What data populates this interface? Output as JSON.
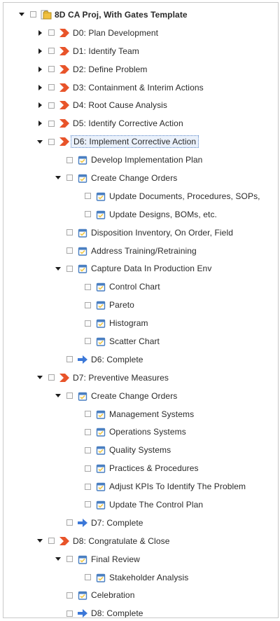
{
  "tree": {
    "rows": [
      {
        "label": "8D CA Proj, With Gates Template",
        "indent": 1,
        "toggle": "down",
        "icon": "project-folder-icon",
        "bold": true
      },
      {
        "label": "D0: Plan Development",
        "indent": 2,
        "toggle": "right",
        "icon": "phase-gate-icon"
      },
      {
        "label": "D1: Identify Team",
        "indent": 2,
        "toggle": "right",
        "icon": "phase-gate-icon"
      },
      {
        "label": "D2: Define Problem",
        "indent": 2,
        "toggle": "right",
        "icon": "phase-gate-icon"
      },
      {
        "label": "D3: Containment & Interim Actions",
        "indent": 2,
        "toggle": "right",
        "icon": "phase-gate-icon"
      },
      {
        "label": "D4: Root Cause Analysis",
        "indent": 2,
        "toggle": "right",
        "icon": "phase-gate-icon"
      },
      {
        "label": "D5: Identify Corrective Action",
        "indent": 2,
        "toggle": "right",
        "icon": "phase-gate-icon"
      },
      {
        "label": "D6: Implement Corrective Action",
        "indent": 2,
        "toggle": "down",
        "icon": "phase-gate-icon",
        "selected": true
      },
      {
        "label": "Develop Implementation Plan",
        "indent": 3,
        "toggle": "none",
        "icon": "task-icon"
      },
      {
        "label": "Create Change Orders",
        "indent": 3,
        "toggle": "down",
        "icon": "task-icon"
      },
      {
        "label": "Update Documents, Procedures, SOPs,",
        "indent": 4,
        "toggle": "none",
        "icon": "task-icon"
      },
      {
        "label": "Update Designs, BOMs, etc.",
        "indent": 4,
        "toggle": "none",
        "icon": "task-icon"
      },
      {
        "label": "Disposition Inventory, On Order, Field",
        "indent": 3,
        "toggle": "none",
        "icon": "task-icon"
      },
      {
        "label": "Address Training/Retraining",
        "indent": 3,
        "toggle": "none",
        "icon": "task-icon"
      },
      {
        "label": "Capture Data In Production Env",
        "indent": 3,
        "toggle": "down",
        "icon": "task-icon"
      },
      {
        "label": "Control Chart",
        "indent": 4,
        "toggle": "none",
        "icon": "task-icon"
      },
      {
        "label": "Pareto",
        "indent": 4,
        "toggle": "none",
        "icon": "task-icon"
      },
      {
        "label": "Histogram",
        "indent": 4,
        "toggle": "none",
        "icon": "task-icon"
      },
      {
        "label": "Scatter Chart",
        "indent": 4,
        "toggle": "none",
        "icon": "task-icon"
      },
      {
        "label": "D6: Complete",
        "indent": 3,
        "toggle": "none",
        "icon": "milestone-arrow-icon"
      },
      {
        "label": "D7: Preventive Measures",
        "indent": 2,
        "toggle": "down",
        "icon": "phase-gate-icon"
      },
      {
        "label": "Create Change Orders",
        "indent": 3,
        "toggle": "down",
        "icon": "task-icon"
      },
      {
        "label": "Management Systems",
        "indent": 4,
        "toggle": "none",
        "icon": "task-icon"
      },
      {
        "label": "Operations Systems",
        "indent": 4,
        "toggle": "none",
        "icon": "task-icon"
      },
      {
        "label": "Quality Systems",
        "indent": 4,
        "toggle": "none",
        "icon": "task-icon"
      },
      {
        "label": "Practices & Procedures",
        "indent": 4,
        "toggle": "none",
        "icon": "task-icon"
      },
      {
        "label": "Adjust KPIs To Identify The Problem",
        "indent": 4,
        "toggle": "none",
        "icon": "task-icon"
      },
      {
        "label": "Update The Control Plan",
        "indent": 4,
        "toggle": "none",
        "icon": "task-icon"
      },
      {
        "label": "D7: Complete",
        "indent": 3,
        "toggle": "none",
        "icon": "milestone-arrow-icon"
      },
      {
        "label": "D8: Congratulate & Close",
        "indent": 2,
        "toggle": "down",
        "icon": "phase-gate-icon"
      },
      {
        "label": "Final Review",
        "indent": 3,
        "toggle": "down",
        "icon": "task-icon"
      },
      {
        "label": "Stakeholder Analysis",
        "indent": 4,
        "toggle": "none",
        "icon": "task-icon"
      },
      {
        "label": "Celebration",
        "indent": 3,
        "toggle": "none",
        "icon": "task-icon"
      },
      {
        "label": "D8: Complete",
        "indent": 3,
        "toggle": "none",
        "icon": "milestone-arrow-icon"
      }
    ]
  },
  "colors": {
    "phase_gate": "#e8542a",
    "task_blue": "#4a7fc1",
    "task_yellow": "#f2c94c",
    "milestone": "#3c78d8",
    "folder": "#f0c040",
    "selection": "#5b87c8"
  }
}
